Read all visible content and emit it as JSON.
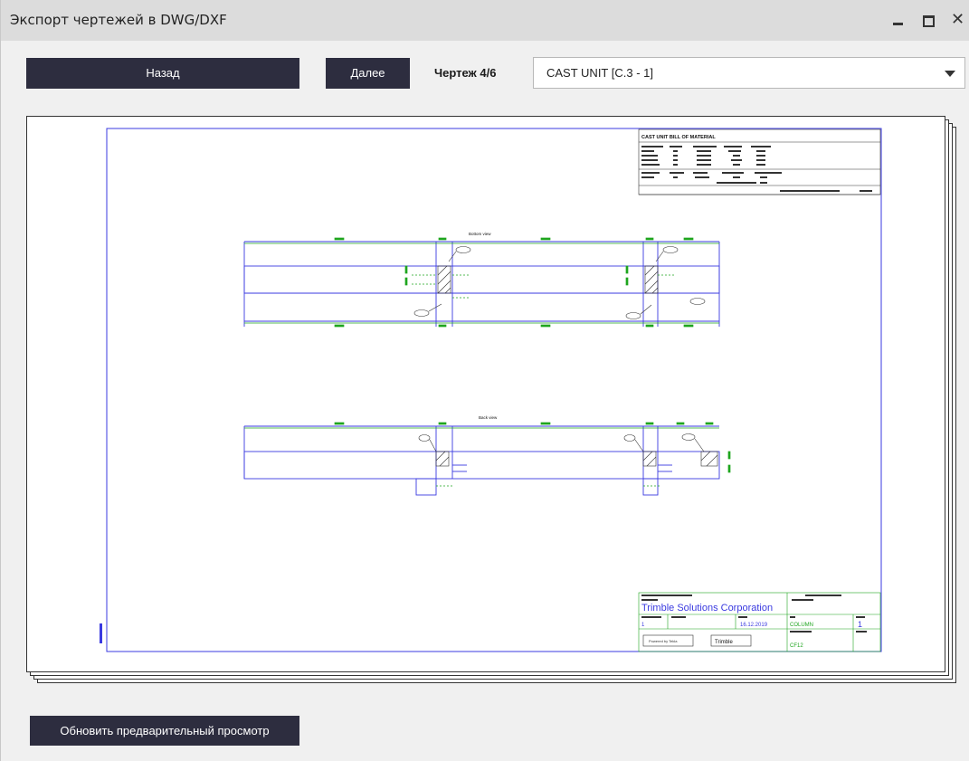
{
  "window": {
    "title": "Экспорт чертежей в DWG/DXF"
  },
  "toolbar": {
    "back_label": "Назад",
    "next_label": "Далее",
    "sheet_counter": "Чертеж 4/6",
    "drawing_select_value": "CAST UNIT [C.3 - 1]"
  },
  "drawing": {
    "bom_title": "CAST UNIT BILL OF MATERIAL",
    "view1_title": "Bottom view",
    "view2_title": "Back view",
    "company": "Trimble Solutions Corporation",
    "date": "16.12.2019",
    "part_name": "COLUMN",
    "mark": "CF12",
    "sheet_no": "1",
    "powered_by": "Powered by Tekla",
    "brand": "Trimble"
  },
  "footer": {
    "refresh_label": "Обновить предварительный просмотр"
  },
  "colors": {
    "dark_button": "#2d2d3f",
    "drawing_frame": "#3a3ae0",
    "dimension_green": "#1fa51f",
    "titlebar": "#dcdcdc"
  }
}
